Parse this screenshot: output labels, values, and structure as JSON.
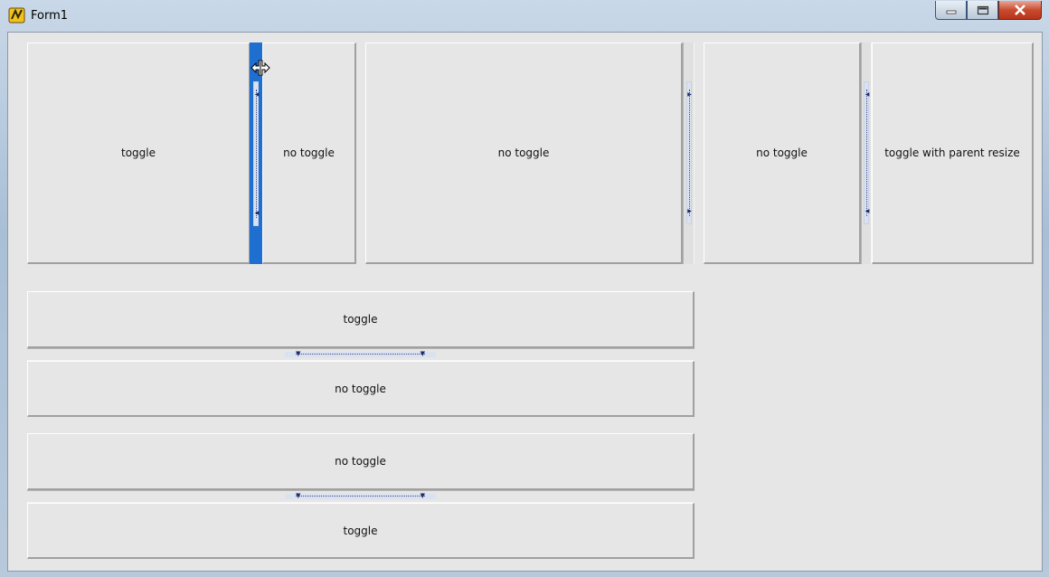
{
  "window": {
    "title": "Form1",
    "icon": "lazarus-cheetah-icon"
  },
  "caption_buttons": {
    "minimize": "minimize-icon",
    "maximize": "maximize-icon",
    "close": "close-icon"
  },
  "panels": {
    "top_left_left": "toggle",
    "top_left_right": "no toggle",
    "top_middle": "no toggle",
    "top_right_left": "no toggle",
    "top_right_right": "toggle with parent resize",
    "mid_top": "toggle",
    "mid_bottom": "no toggle",
    "bottom_top": "no toggle",
    "bottom_bottom": "toggle"
  },
  "colors": {
    "splitter_active": "#1f6fd0",
    "close_button": "#c94c2f"
  }
}
